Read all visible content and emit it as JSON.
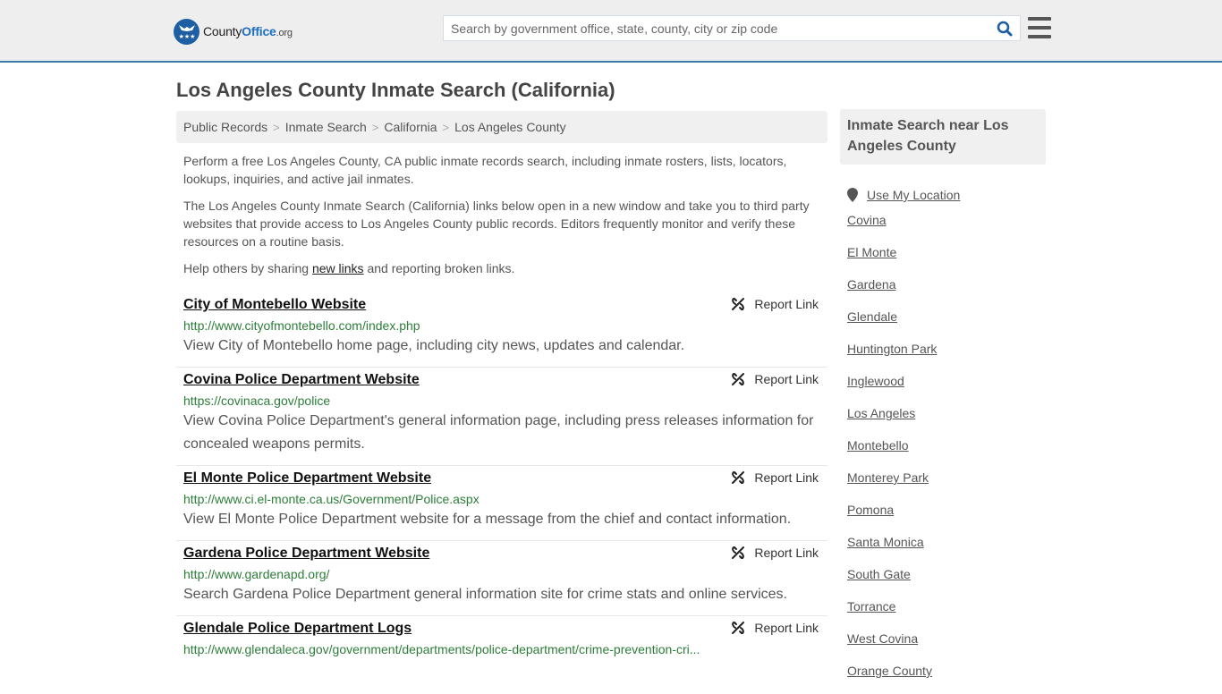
{
  "header": {
    "logo": {
      "name_part1": "County",
      "name_part2": "Office",
      "tld": ".org"
    },
    "search": {
      "placeholder": "Search by government office, state, county, city or zip code",
      "value": ""
    },
    "colors": {
      "accent": "#3a7bab",
      "brand_blue": "#1e5fa3"
    }
  },
  "page": {
    "title": "Los Angeles County Inmate Search (California)",
    "breadcrumb": [
      "Public Records",
      "Inmate Search",
      "California",
      "Los Angeles County"
    ],
    "intro": {
      "p1": "Perform a free Los Angeles County, CA public inmate records search, including inmate rosters, lists, locators, lookups, inquiries, and active jail inmates.",
      "p2": "The Los Angeles County Inmate Search (California) links below open in a new window and take you to third party websites that provide access to Los Angeles County public records. Editors frequently monitor and verify these resources on a routine basis.",
      "p3_before": "Help others by sharing ",
      "p3_link": "new links",
      "p3_after": " and reporting broken links."
    }
  },
  "results": [
    {
      "title": "City of Montebello Website",
      "url": "http://www.cityofmontebello.com/index.php",
      "description": "View City of Montebello home page, including city news, updates and calendar.",
      "report_label": "Report Link"
    },
    {
      "title": "Covina Police Department Website",
      "url": "https://covinaca.gov/police",
      "description": "View Covina Police Department's general information page, including press releases information for concealed weapons permits.",
      "report_label": "Report Link"
    },
    {
      "title": "El Monte Police Department Website",
      "url": "http://www.ci.el-monte.ca.us/Government/Police.aspx",
      "description": "View El Monte Police Department website for a message from the chief and contact information.",
      "report_label": "Report Link"
    },
    {
      "title": "Gardena Police Department Website",
      "url": "http://www.gardenapd.org/",
      "description": "Search Gardena Police Department general information site for crime stats and online services.",
      "report_label": "Report Link"
    },
    {
      "title": "Glendale Police Department Logs",
      "url": "http://www.glendaleca.gov/government/departments/police-department/crime-prevention-cri...",
      "description": "",
      "report_label": "Report Link"
    }
  ],
  "sidebar": {
    "heading": "Inmate Search near Los Angeles County",
    "use_location": "Use My Location",
    "places": [
      "Covina",
      "El Monte",
      "Gardena",
      "Glendale",
      "Huntington Park",
      "Inglewood",
      "Los Angeles",
      "Montebello",
      "Monterey Park",
      "Pomona",
      "Santa Monica",
      "South Gate",
      "Torrance",
      "West Covina",
      "Orange County"
    ]
  }
}
